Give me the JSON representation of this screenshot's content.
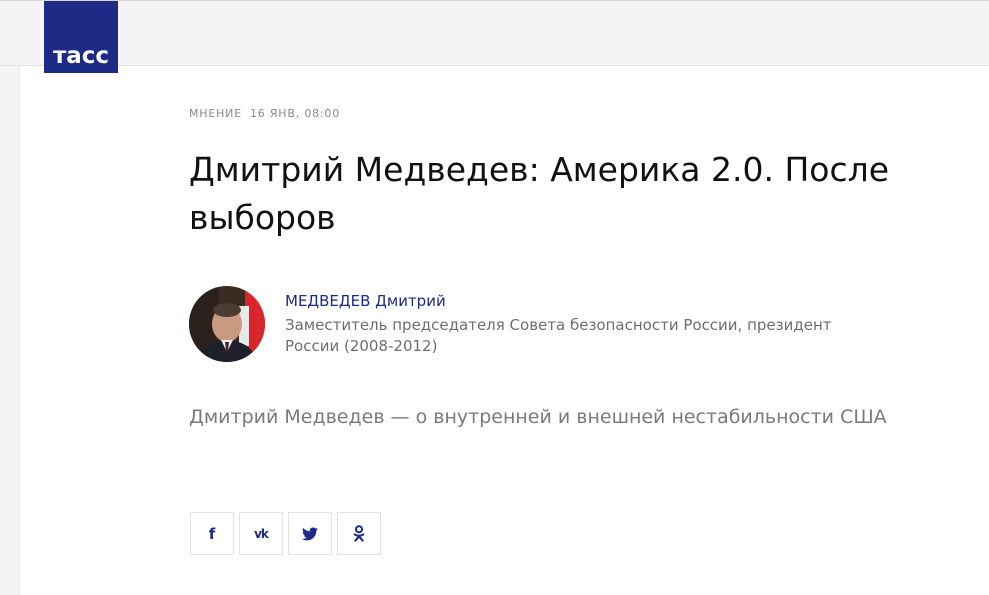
{
  "brand": {
    "logo_text": "тасс",
    "color": "#1d2a86"
  },
  "article": {
    "category": "МНЕНИЕ",
    "date": "16 ЯНВ, 08:00",
    "title": "Дмитрий Медведев: Америка 2.0. После выборов",
    "lead": "Дмитрий Медведев — о внутренней и внешней нестабильности США"
  },
  "author": {
    "name": "МЕДВЕДЕВ Дмитрий",
    "role": "Заместитель председателя Совета безопасности России, президент России (2008-2012)"
  },
  "share": {
    "buttons": [
      {
        "network": "facebook",
        "icon": "facebook-icon",
        "glyph": "f"
      },
      {
        "network": "vkontakte",
        "icon": "vk-icon",
        "glyph": "vk"
      },
      {
        "network": "twitter",
        "icon": "twitter-icon"
      },
      {
        "network": "odnoklassniki",
        "icon": "odnoklassniki-icon"
      }
    ]
  }
}
